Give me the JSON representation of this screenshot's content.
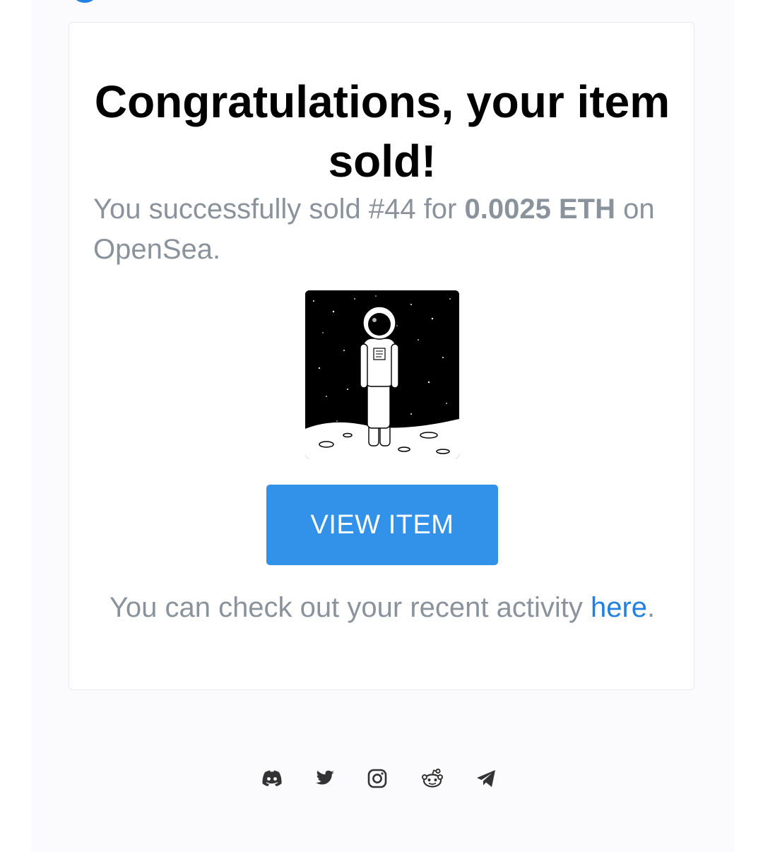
{
  "card": {
    "title": "Congratulations, your item sold!",
    "desc_prefix": "You successfully sold #44 for ",
    "price": "0.0025 ETH",
    "desc_suffix": " on OpenSea.",
    "view_button_label": "VIEW ITEM",
    "activity_prefix": "You can check out your recent activity ",
    "activity_link": "here",
    "activity_suffix": "."
  },
  "socials": [
    "discord-icon",
    "twitter-icon",
    "instagram-icon",
    "reddit-icon",
    "telegram-icon"
  ],
  "colors": {
    "brand_blue": "#2081e2",
    "button_blue": "#3291e9",
    "muted_text": "#8a939b"
  }
}
